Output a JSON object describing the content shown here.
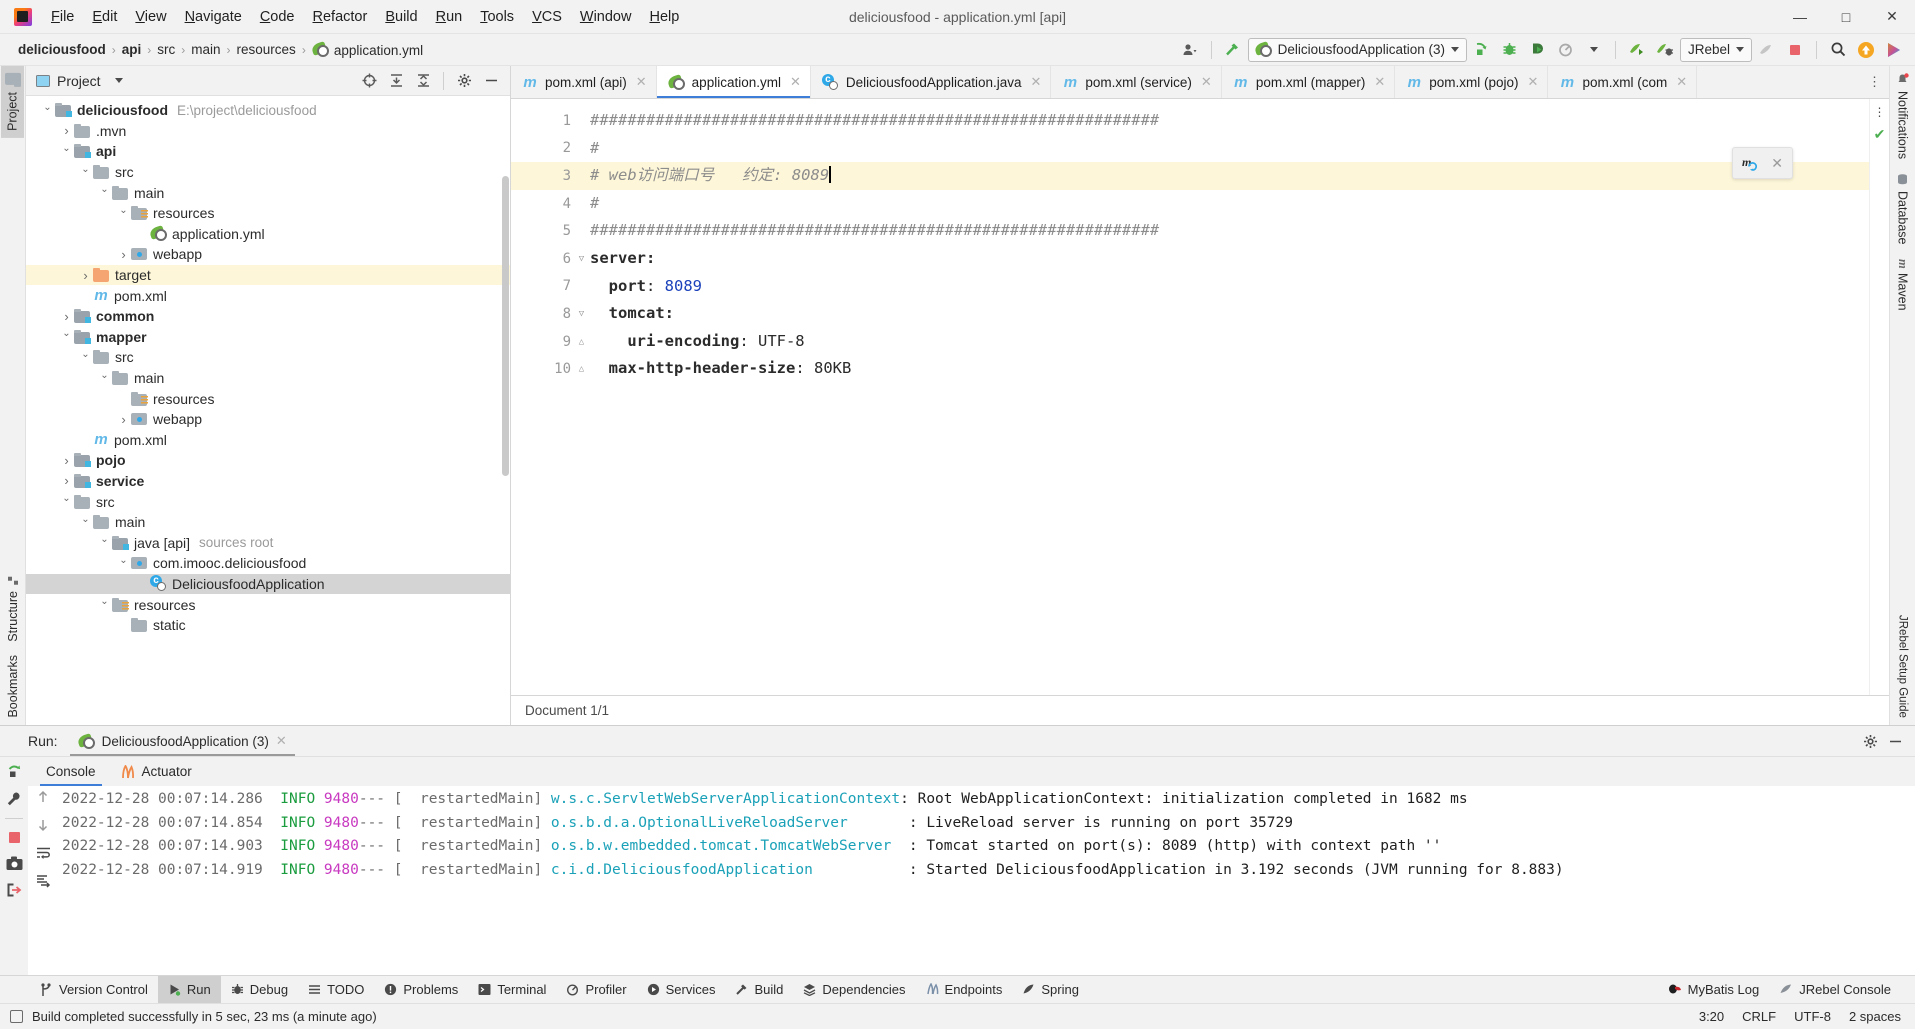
{
  "window": {
    "title": "deliciousfood - application.yml [api]"
  },
  "menu": [
    "File",
    "Edit",
    "View",
    "Navigate",
    "Code",
    "Refactor",
    "Build",
    "Run",
    "Tools",
    "VCS",
    "Window",
    "Help"
  ],
  "win_controls": {
    "minimize": "—",
    "maximize": "□",
    "close": "✕"
  },
  "breadcrumb": {
    "items": [
      "deliciousfood",
      "api",
      "src",
      "main",
      "resources",
      "application.yml"
    ],
    "separator": "›"
  },
  "toolbar": {
    "run_config": "DeliciousfoodApplication (3)",
    "jrebel": "JRebel",
    "icons": [
      "user-icon",
      "build-hammer-icon",
      "run-icon",
      "debug-icon",
      "run-coverage-icon",
      "profiler-icon",
      "jrebel-run-icon",
      "jrebel-debug-icon",
      "stop-icon",
      "search-icon",
      "update-icon",
      "ide-feature-icon"
    ]
  },
  "project_panel": {
    "title": "Project",
    "tree": [
      {
        "indent": 0,
        "arrow": "open",
        "icon": "module-folder",
        "label": "deliciousfood",
        "bold": true,
        "sub": "E:\\project\\deliciousfood"
      },
      {
        "indent": 1,
        "arrow": "closed",
        "icon": "folder",
        "label": ".mvn",
        "bold": false
      },
      {
        "indent": 1,
        "arrow": "open",
        "icon": "module-folder",
        "label": "api",
        "bold": true
      },
      {
        "indent": 2,
        "arrow": "open",
        "icon": "folder",
        "label": "src",
        "bold": false
      },
      {
        "indent": 3,
        "arrow": "open",
        "icon": "folder",
        "label": "main",
        "bold": false
      },
      {
        "indent": 4,
        "arrow": "open",
        "icon": "resources-folder",
        "label": "resources",
        "bold": false
      },
      {
        "indent": 5,
        "arrow": "none",
        "icon": "spring-yaml",
        "label": "application.yml",
        "bold": false
      },
      {
        "indent": 4,
        "arrow": "closed",
        "icon": "package-folder",
        "label": "webapp",
        "bold": false
      },
      {
        "indent": 2,
        "arrow": "closed",
        "icon": "target-folder",
        "label": "target",
        "bold": false,
        "highlight": true
      },
      {
        "indent": 2,
        "arrow": "none",
        "icon": "maven",
        "label": "pom.xml",
        "bold": false
      },
      {
        "indent": 1,
        "arrow": "closed",
        "icon": "module-folder",
        "label": "common",
        "bold": true
      },
      {
        "indent": 1,
        "arrow": "open",
        "icon": "module-folder",
        "label": "mapper",
        "bold": true
      },
      {
        "indent": 2,
        "arrow": "open",
        "icon": "folder",
        "label": "src",
        "bold": false
      },
      {
        "indent": 3,
        "arrow": "open",
        "icon": "folder",
        "label": "main",
        "bold": false
      },
      {
        "indent": 4,
        "arrow": "none",
        "icon": "resources-folder",
        "label": "resources",
        "bold": false
      },
      {
        "indent": 4,
        "arrow": "closed",
        "icon": "package-folder",
        "label": "webapp",
        "bold": false
      },
      {
        "indent": 2,
        "arrow": "none",
        "icon": "maven",
        "label": "pom.xml",
        "bold": false
      },
      {
        "indent": 1,
        "arrow": "closed",
        "icon": "module-folder",
        "label": "pojo",
        "bold": true
      },
      {
        "indent": 1,
        "arrow": "closed",
        "icon": "module-folder",
        "label": "service",
        "bold": true
      },
      {
        "indent": 1,
        "arrow": "open",
        "icon": "folder",
        "label": "src",
        "bold": false
      },
      {
        "indent": 2,
        "arrow": "open",
        "icon": "folder",
        "label": "main",
        "bold": false
      },
      {
        "indent": 3,
        "arrow": "open",
        "icon": "module-folder",
        "label": "java [api]",
        "bold": false,
        "sub": "sources root"
      },
      {
        "indent": 4,
        "arrow": "open",
        "icon": "package-folder",
        "label": "com.imooc.deliciousfood",
        "bold": false
      },
      {
        "indent": 5,
        "arrow": "none",
        "icon": "java-class",
        "label": "DeliciousfoodApplication",
        "bold": false,
        "selected": true
      },
      {
        "indent": 3,
        "arrow": "open",
        "icon": "resources-folder",
        "label": "resources",
        "bold": false
      },
      {
        "indent": 4,
        "arrow": "none",
        "icon": "folder",
        "label": "static",
        "bold": false
      }
    ]
  },
  "editor": {
    "tabs": [
      {
        "label": "pom.xml (api)",
        "icon": "maven-icon",
        "active": false
      },
      {
        "label": "application.yml",
        "icon": "spring-yaml-icon",
        "active": true
      },
      {
        "label": "DeliciousfoodApplication.java",
        "icon": "java-class-icon",
        "active": false
      },
      {
        "label": "pom.xml (service)",
        "icon": "maven-icon",
        "active": false
      },
      {
        "label": "pom.xml (mapper)",
        "icon": "maven-icon",
        "active": false
      },
      {
        "label": "pom.xml (pojo)",
        "icon": "maven-icon",
        "active": false
      },
      {
        "label": "pom.xml (com",
        "icon": "maven-icon",
        "active": false
      }
    ],
    "lines": [
      {
        "n": 1,
        "text": "#############################################################"
      },
      {
        "n": 2,
        "text": "#"
      },
      {
        "n": 3,
        "text": "# web访问端口号   约定: 8089",
        "highlight": true,
        "caret": true
      },
      {
        "n": 4,
        "text": "#"
      },
      {
        "n": 5,
        "text": "#############################################################"
      },
      {
        "n": 6,
        "text": "server:",
        "kind": "key",
        "fold": "open"
      },
      {
        "n": 7,
        "text": "  port: 8089",
        "kind": "kv",
        "key": "  port",
        "value": "8089"
      },
      {
        "n": 8,
        "text": "  tomcat:",
        "kind": "key",
        "fold": "open"
      },
      {
        "n": 9,
        "text": "    uri-encoding: UTF-8",
        "kind": "kv",
        "key": "    uri-encoding",
        "value": "UTF-8",
        "fold": "end"
      },
      {
        "n": 10,
        "text": "  max-http-header-size: 80KB",
        "kind": "kv",
        "key": "  max-http-header-size",
        "value": "80KB",
        "fold": "end"
      }
    ],
    "document_status": "Document 1/1",
    "maven_widget": {
      "icon": "maven-reload-icon",
      "close": "✕"
    },
    "inspection_status": "✔"
  },
  "run_panel": {
    "label": "Run:",
    "tab": "DeliciousfoodApplication (3)",
    "console_tabs": [
      {
        "label": "Console",
        "active": true
      },
      {
        "label": "Actuator",
        "active": false
      }
    ],
    "lines": [
      {
        "time": "2022-12-28 00:07:14.286",
        "level": "INFO",
        "pid": "9480",
        "sep": "--- [",
        "thread": "  restartedMain]",
        "logger": "w.s.c.ServletWebServerApplicationContext",
        "colon": ": ",
        "msg": "Root WebApplicationContext: initialization completed in 1682 ms"
      },
      {
        "time": "2022-12-28 00:07:14.854",
        "level": "INFO",
        "pid": "9480",
        "sep": "--- [",
        "thread": "  restartedMain]",
        "logger": "o.s.b.d.a.OptionalLiveReloadServer",
        "colon": "       : ",
        "msg": "LiveReload server is running on port 35729"
      },
      {
        "time": "2022-12-28 00:07:14.903",
        "level": "INFO",
        "pid": "9480",
        "sep": "--- [",
        "thread": "  restartedMain]",
        "logger": "o.s.b.w.embedded.tomcat.TomcatWebServer",
        "colon": "  : ",
        "msg": "Tomcat started on port(s): 8089 (http) with context path ''"
      },
      {
        "time": "2022-12-28 00:07:14.919",
        "level": "INFO",
        "pid": "9480",
        "sep": "--- [",
        "thread": "  restartedMain]",
        "logger": "c.i.d.DeliciousfoodApplication",
        "colon": "           : ",
        "msg": "Started DeliciousfoodApplication in 3.192 seconds (JVM running for 8.883)"
      }
    ]
  },
  "left_stripe": [
    {
      "label": "Project",
      "active": true
    },
    {
      "label": "Structure",
      "active": false
    },
    {
      "label": "Bookmarks",
      "active": false
    }
  ],
  "right_stripe": [
    {
      "label": "Notifications",
      "active": false
    },
    {
      "label": "Database",
      "active": false
    },
    {
      "label": "Maven",
      "active": false
    }
  ],
  "toolwindow_bar": {
    "items": [
      {
        "label": "Version Control",
        "icon": "branch-icon",
        "active": false
      },
      {
        "label": "Run",
        "icon": "run-icon",
        "active": true
      },
      {
        "label": "Debug",
        "icon": "bug-icon",
        "active": false
      },
      {
        "label": "TODO",
        "icon": "list-icon",
        "active": false
      },
      {
        "label": "Problems",
        "icon": "warning-icon",
        "active": false
      },
      {
        "label": "Terminal",
        "icon": "terminal-icon",
        "active": false
      },
      {
        "label": "Profiler",
        "icon": "profiler-icon",
        "active": false
      },
      {
        "label": "Services",
        "icon": "services-icon",
        "active": false
      },
      {
        "label": "Build",
        "icon": "hammer-icon",
        "active": false
      },
      {
        "label": "Dependencies",
        "icon": "layers-icon",
        "active": false
      },
      {
        "label": "Endpoints",
        "icon": "endpoints-icon",
        "active": false
      },
      {
        "label": "Spring",
        "icon": "spring-icon",
        "active": false
      }
    ],
    "right_items": [
      {
        "label": "MyBatis Log",
        "icon": "mybatis-icon"
      },
      {
        "label": "JRebel Console",
        "icon": "jrebel-icon"
      }
    ]
  },
  "statusbar": {
    "message": "Build completed successfully in 5 sec, 23 ms (a minute ago)",
    "caret_position": "3:20",
    "line_separator": "CRLF",
    "encoding": "UTF-8",
    "indent": "2 spaces"
  },
  "colors": {
    "accent_blue": "#3e7ed8",
    "spring_green": "#6db33f",
    "highlight_yellow": "#fdf6d8",
    "selection_gray": "#d4d4d4",
    "info_green": "#1a9c3e",
    "pid_magenta": "#c838c0",
    "logger_cyan": "#1aa1b8",
    "number_blue": "#1a41bb"
  }
}
